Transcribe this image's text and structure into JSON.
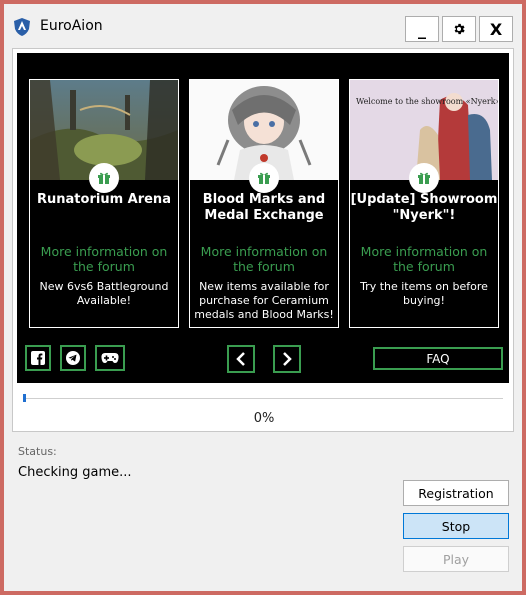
{
  "window": {
    "title": "EuroAion",
    "minimize_label": "_",
    "close_label": "X"
  },
  "news": [
    {
      "title": "Runatorium Arena",
      "link": "More information on the forum",
      "description": "New 6vs6 Battleground Available!"
    },
    {
      "title": "Blood Marks and Medal Exchange",
      "link": "More information on the forum",
      "description": "New items available for purchase for Ceramium medals and Blood Marks!"
    },
    {
      "title": "[Update] Showroom \"Nyerk\"!",
      "link": "More information on the forum",
      "description": "Try the items on before buying!",
      "image_text": "Welcome to the showroom «Nyerk»!"
    }
  ],
  "social": [
    "facebook-icon",
    "telegram-icon",
    "gamepad-icon"
  ],
  "faq_label": "FAQ",
  "progress": {
    "fraction": 0.0,
    "text": "0%"
  },
  "status": {
    "label": "Status:",
    "text": "Checking game..."
  },
  "actions": {
    "registration": "Registration",
    "stop": "Stop",
    "play": "Play"
  },
  "colors": {
    "accent_green": "#3a9d50",
    "frame_red": "#cd6a62",
    "progress_blue": "#1f6fd0"
  }
}
